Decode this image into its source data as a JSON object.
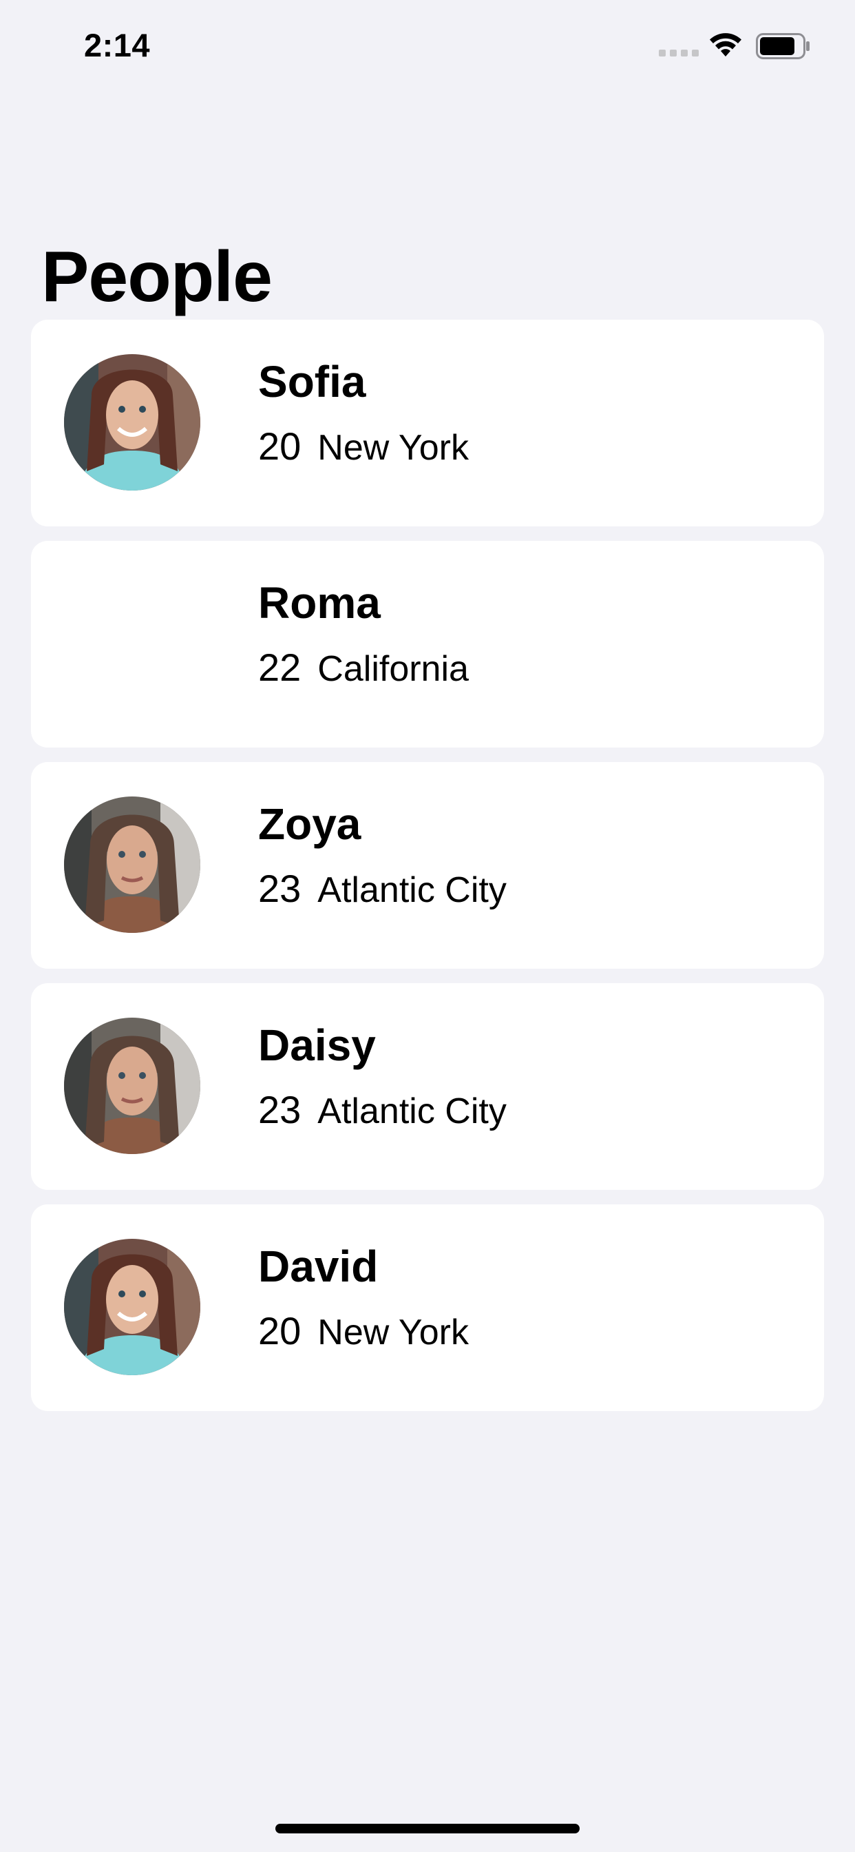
{
  "status_bar": {
    "time": "2:14"
  },
  "title": "People",
  "people": [
    {
      "name": "Sofia",
      "age": "20",
      "city": "New York",
      "photo": "portrait-smiling-teal-top",
      "has_photo": true
    },
    {
      "name": "Roma",
      "age": "22",
      "city": "California",
      "photo": "",
      "has_photo": false
    },
    {
      "name": "Zoya",
      "age": "23",
      "city": "Atlantic City",
      "photo": "portrait-selfie-car",
      "has_photo": true
    },
    {
      "name": "Daisy",
      "age": "23",
      "city": "Atlantic City",
      "photo": "portrait-selfie-car",
      "has_photo": true
    },
    {
      "name": "David",
      "age": "20",
      "city": "New York",
      "photo": "portrait-smiling-teal-top",
      "has_photo": true
    }
  ],
  "colors": {
    "background": "#f2f2f7",
    "card": "#ffffff",
    "text": "#000000"
  }
}
